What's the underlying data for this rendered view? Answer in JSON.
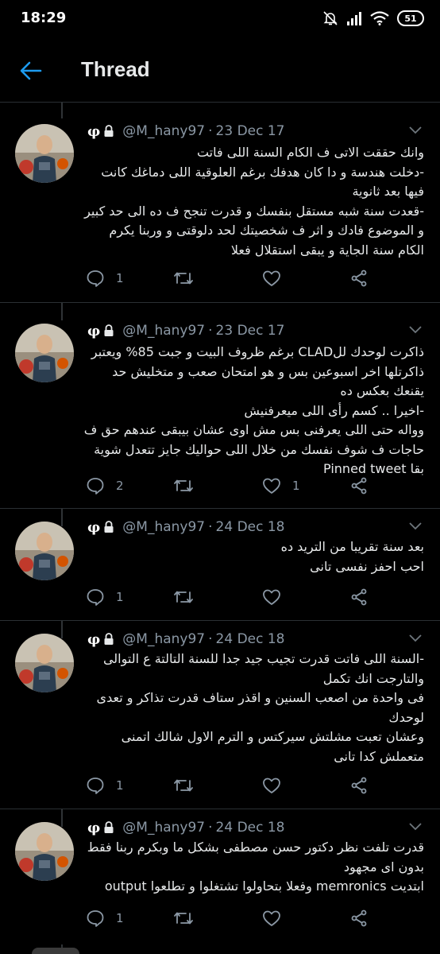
{
  "status_bar": {
    "time": "18:29",
    "battery": "51"
  },
  "header": {
    "title": "Thread"
  },
  "tweets": [
    {
      "name_symbol": "φ",
      "handle": "@M_hany97",
      "sep": "·",
      "date": "23 Dec 17",
      "text": "وانك حققت الاتى ف الكام السنة اللى فاتت\n-دخلت هندسة و دا كان هدفك برغم العلوقية اللى دماغك كانت فيها بعد ثانوية\n-قعدت سنة شبه مستقل بنفسك و قدرت تنجح ف ده الى حد كبير و الموضوع فادك و اثر ف شخصيتك لحد دلوقتى و وربنا يكرم الكام سنة الجاية و يبقى استقلال فعلا",
      "reply_count": "1",
      "retweet_count": "",
      "like_count": ""
    },
    {
      "name_symbol": "φ",
      "handle": "@M_hany97",
      "sep": "·",
      "date": "23 Dec 17",
      "text": "ذاكرت لوحدك لل‏CLAD برغم ظروف البيت و جبت 85% ويعتبر ذاكرتلها اخر اسبوعين بس و هو امتحان صعب و متخليش حد يقنعك بعكس ده\n-اخيرا .. كسم رأى اللى ميعرفنيش\nوواله حتى اللى يعرفنى بس مش اوى عشان بيبقى عندهم حق ف حاجات ف شوف نفسك من خلال اللى حواليك جايز تتعدل شوية بقا Pinned tweet",
      "reply_count": "2",
      "retweet_count": "",
      "like_count": "1"
    },
    {
      "name_symbol": "φ",
      "handle": "@M_hany97",
      "sep": "·",
      "date": "24 Dec 18",
      "text": "بعد سنة تقريبا من التريد ده\nاحب احفز نفسى تانى",
      "reply_count": "1",
      "retweet_count": "",
      "like_count": ""
    },
    {
      "name_symbol": "φ",
      "handle": "@M_hany97",
      "sep": "·",
      "date": "24 Dec 18",
      "text": "-السنة اللى فاتت قدرت تجيب جيد جدا للسنة التالتة ع التوالى والتارجت انك تكمل\nفى واحدة من اصعب السنين و اقذر ستاف قدرت تذاكر و تعدى لوحدك\nوعشان تعبت مشلتش سيركتس و الترم الاول شالك اتمنى متعملش كدا تانى",
      "reply_count": "1",
      "retweet_count": "",
      "like_count": ""
    },
    {
      "name_symbol": "φ",
      "handle": "@M_hany97",
      "sep": "·",
      "date": "24 Dec 18",
      "text": "قدرت تلفت نظر دكتور حسن مصطفى بشكل ما وبكرم ربنا فقط بدون اى مجهود\nابتديت memronics وفعلا بتحاولوا تشتغلوا و تطلعوا output",
      "reply_count": "1",
      "retweet_count": "",
      "like_count": ""
    }
  ]
}
